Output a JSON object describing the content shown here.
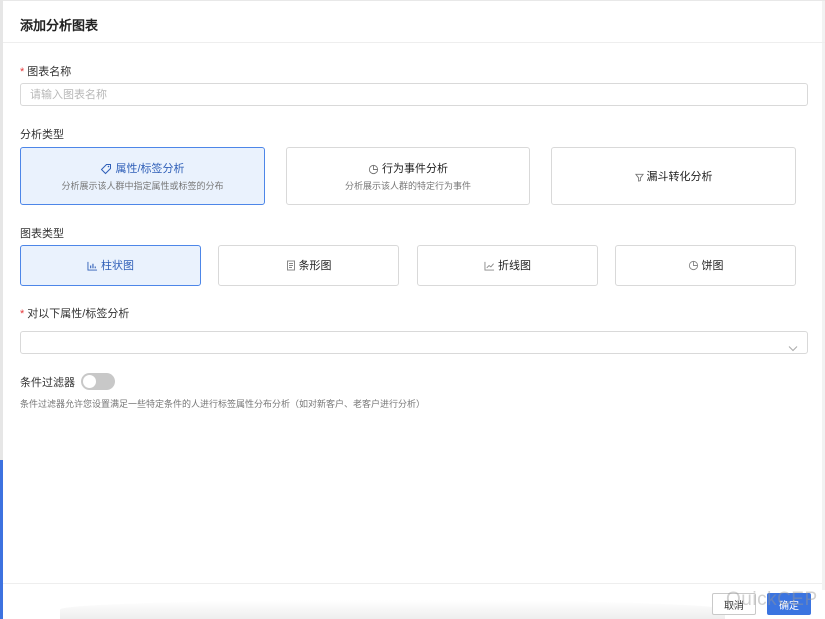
{
  "dialog": {
    "title": "添加分析图表"
  },
  "chart_name": {
    "label": "图表名称",
    "required_mark": "*",
    "placeholder": "请输入图表名称",
    "value": ""
  },
  "analysis_type": {
    "label": "分析类型",
    "options": [
      {
        "title": "属性/标签分析",
        "subtitle": "分析展示该人群中指定属性或标签的分布",
        "icon": "tag-icon",
        "selected": true
      },
      {
        "title": "行为事件分析",
        "subtitle": "分析展示该人群的特定行为事件",
        "icon": "pie-chart-icon",
        "selected": false
      },
      {
        "title": "漏斗转化分析",
        "subtitle": "",
        "icon": "funnel-icon",
        "selected": false
      }
    ]
  },
  "chart_type": {
    "label": "图表类型",
    "options": [
      {
        "title": "柱状图",
        "icon": "bar-chart-icon",
        "selected": true
      },
      {
        "title": "条形图",
        "icon": "document-icon",
        "selected": false
      },
      {
        "title": "折线图",
        "icon": "line-chart-icon",
        "selected": false
      },
      {
        "title": "饼图",
        "icon": "pie-chart-icon",
        "selected": false
      }
    ]
  },
  "attribute_select": {
    "label": "对以下属性/标签分析",
    "required_mark": "*",
    "value": ""
  },
  "filter": {
    "label": "条件过滤器",
    "enabled": false,
    "help": "条件过滤器允许您设置满足一些特定条件的人进行标签属性分布分析（如对新客户、老客户进行分析）"
  },
  "footer": {
    "cancel_label": "取消",
    "ok_label": "确定"
  },
  "watermark": "QuickCEP",
  "colors": {
    "accent": "#3b74e0",
    "selected_bg": "#eaf2fd",
    "required": "#e5393b"
  }
}
